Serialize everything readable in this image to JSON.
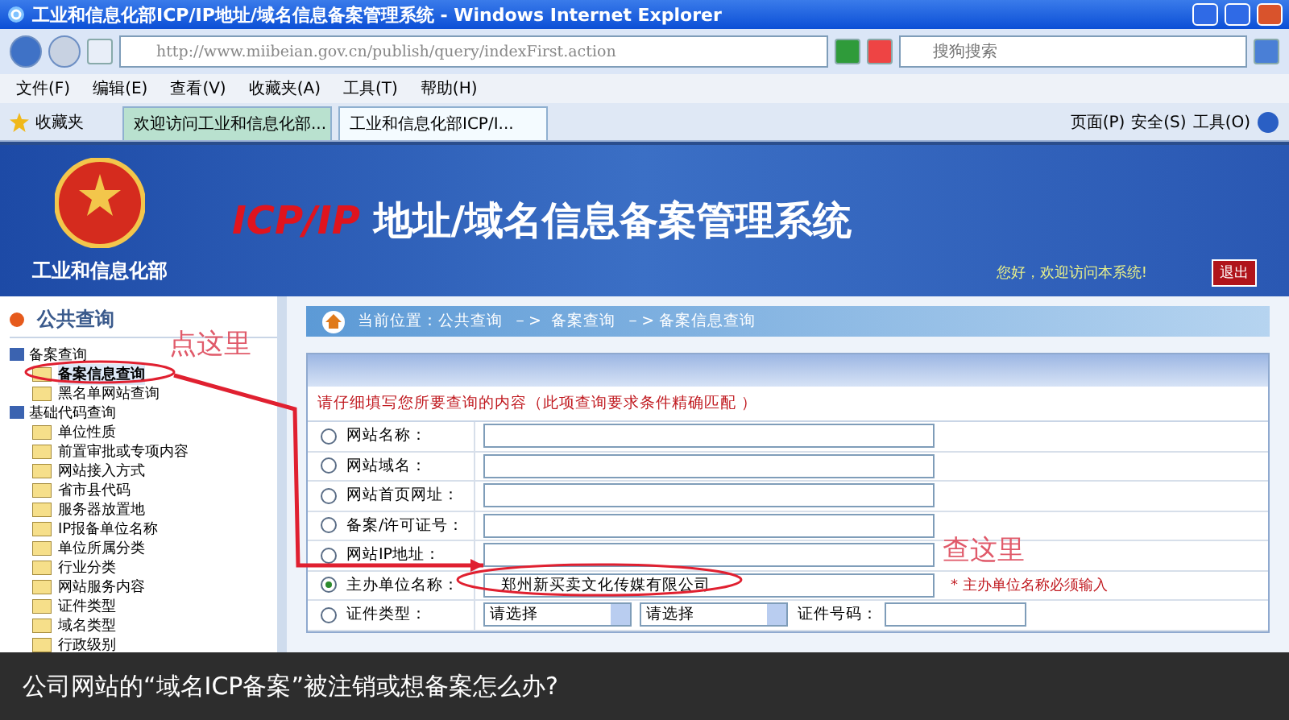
{
  "window": {
    "title": "工业和信息化部ICP/IP地址/域名信息备案管理系统 - Windows Internet Explorer"
  },
  "address_bar": {
    "url": "http://www.miibeian.gov.cn/publish/query/indexFirst.action"
  },
  "search": {
    "placeholder": "搜狗搜索"
  },
  "menu": [
    "文件(F)",
    "编辑(E)",
    "查看(V)",
    "收藏夹(A)",
    "工具(T)",
    "帮助(H)"
  ],
  "favorites": {
    "label": "收藏夹"
  },
  "tabs": [
    {
      "label": "欢迎访问工业和信息化部...",
      "selected": false
    },
    {
      "label": "工业和信息化部ICP/I...",
      "selected": true
    }
  ],
  "command_bar": [
    "页面(P)",
    "安全(S)",
    "工具(O)"
  ],
  "banner": {
    "org": "工业和信息化部",
    "title_prefix": "ICP/IP",
    "title_rest": "地址/域名信息备案管理系统",
    "welcome": "您好，欢迎访问本系统!",
    "logout": "退出"
  },
  "sidebar": {
    "heading": "公共查询",
    "tree": [
      {
        "label": "备案查询",
        "children": [
          {
            "label": "备案信息查询",
            "selected": true
          },
          {
            "label": "黑名单网站查询",
            "selected": false
          }
        ]
      },
      {
        "label": "基础代码查询",
        "children": [
          {
            "label": "单位性质",
            "selected": false
          },
          {
            "label": "前置审批或专项内容",
            "selected": false
          },
          {
            "label": "网站接入方式",
            "selected": false
          },
          {
            "label": "省市县代码",
            "selected": false
          },
          {
            "label": "服务器放置地",
            "selected": false
          },
          {
            "label": "IP报备单位名称",
            "selected": false
          },
          {
            "label": "单位所属分类",
            "selected": false
          },
          {
            "label": "行业分类",
            "selected": false
          },
          {
            "label": "网站服务内容",
            "selected": false
          },
          {
            "label": "证件类型",
            "selected": false
          },
          {
            "label": "域名类型",
            "selected": false
          },
          {
            "label": "行政级别",
            "selected": false
          }
        ]
      }
    ]
  },
  "breadcrumb": "当前位置：公共查询  －>  备案查询  －> 备案信息查询",
  "form": {
    "instruction": "请仔细填写您所要查询的内容（此项查询要求条件精确匹配 ）",
    "rows": [
      {
        "kind": "text",
        "label": "网站名称：",
        "selected": false
      },
      {
        "kind": "text",
        "label": "网站域名：",
        "selected": false
      },
      {
        "kind": "text",
        "label": "网站首页网址：",
        "selected": false
      },
      {
        "kind": "text",
        "label": "备案/许可证号：",
        "selected": false
      },
      {
        "kind": "text",
        "label": "网站IP地址：",
        "selected": false
      },
      {
        "kind": "text",
        "label": "主办单位名称：",
        "selected": true,
        "value": "郑州新买卖文化传媒有限公司",
        "note": "* 主办单位名称必须输入"
      },
      {
        "kind": "cert",
        "label": "证件类型：",
        "selected": false,
        "select_1": "请选择",
        "select_2": "请选择",
        "number_label": "证件号码："
      }
    ]
  },
  "annotations": [
    {
      "text": "点这里"
    },
    {
      "text": "查这里"
    }
  ],
  "caption": "公司网站的“域名ICP备案”被注销或想备案怎么办?"
}
